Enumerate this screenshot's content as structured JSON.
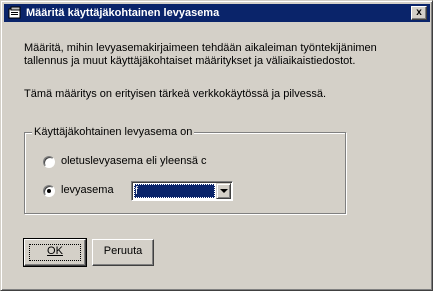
{
  "window": {
    "title": "Määritä käyttäjäkohtainen levyasema",
    "close_glyph": "x"
  },
  "body": {
    "paragraph1_line1": "Määritä, mihin levyasemakirjaimeen tehdään aikaleiman työntekijänimen",
    "paragraph1_line2": "tallennus ja muut käyttäjäkohtaiset määritykset ja väliaikaistiedostot.",
    "paragraph2": "Tämä määritys on erityisen tärkeä verkkokäytössä ja pilvessä."
  },
  "group": {
    "legend": "Käyttäjäkohtainen levyasema on",
    "options": [
      {
        "label": "oletuslevyasema eli yleensä c",
        "selected": false
      },
      {
        "label": "levyasema",
        "selected": true
      }
    ],
    "drive_select": {
      "value": "f"
    }
  },
  "buttons": {
    "ok_label": "OK",
    "cancel_label": "Peruuta"
  },
  "colors": {
    "face": "#d4d0c8",
    "titlebar": "#0a246a",
    "selection": "#0a246a"
  }
}
